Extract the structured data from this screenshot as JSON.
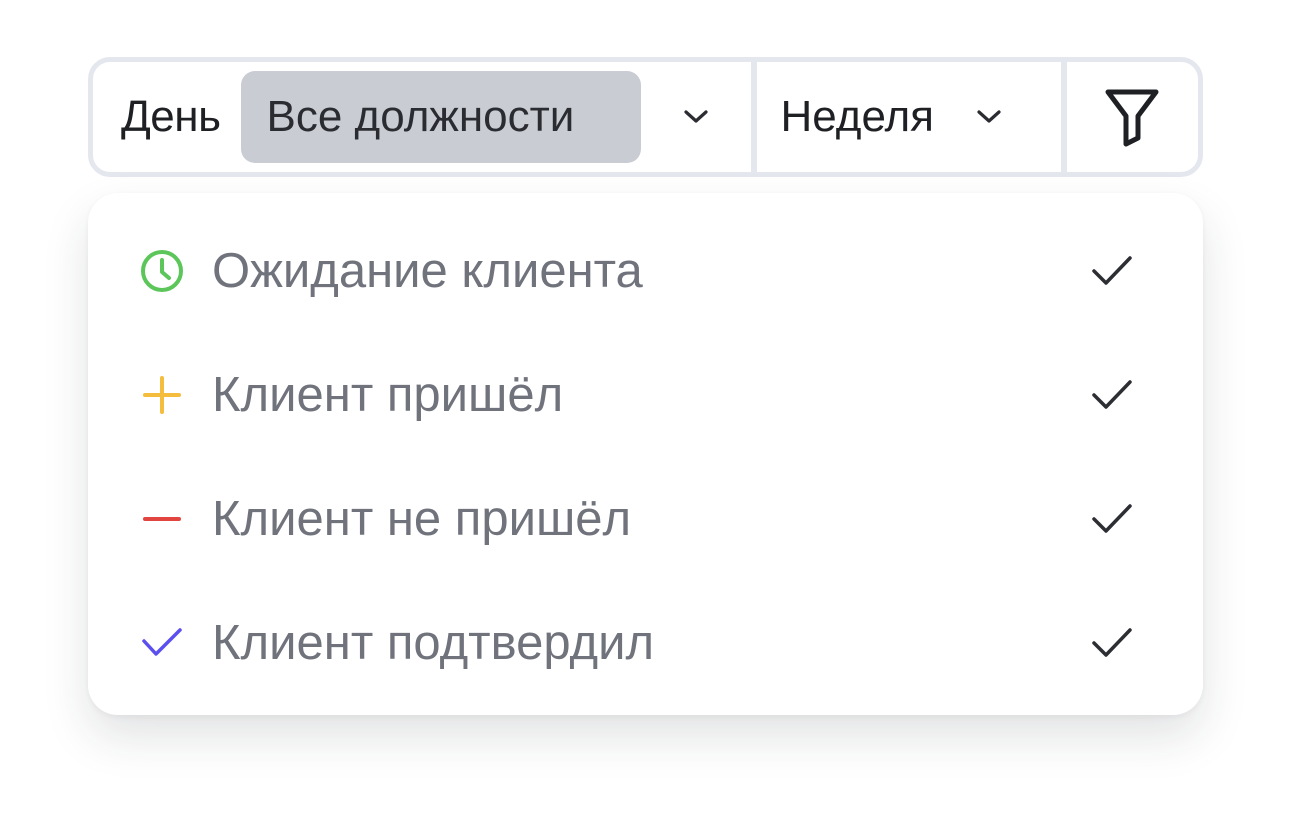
{
  "toolbar": {
    "day_label": "День",
    "positions_label": "Все должности",
    "positions_chevron_icon": "chevron-down-icon",
    "week_label": "Неделя",
    "week_chevron_icon": "chevron-down-icon",
    "filter_icon": "filter-icon"
  },
  "status_filter": {
    "items": [
      {
        "label": "Ожидание клиента",
        "icon": "clock-icon",
        "color": "#5cc65a",
        "checked": true
      },
      {
        "label": "Клиент пришёл",
        "icon": "plus-icon",
        "color": "#f5bd3d",
        "checked": true
      },
      {
        "label": "Клиент не пришёл",
        "icon": "minus-icon",
        "color": "#e2443f",
        "checked": true
      },
      {
        "label": "Клиент подтвердил",
        "icon": "check-icon",
        "color": "#5b4ff0",
        "checked": true
      }
    ]
  },
  "colors": {
    "toolbar_border": "#e4e7ee",
    "selected_bg": "#c9cdd3",
    "item_text": "#70737c",
    "checkmark": "#2c2e33"
  }
}
